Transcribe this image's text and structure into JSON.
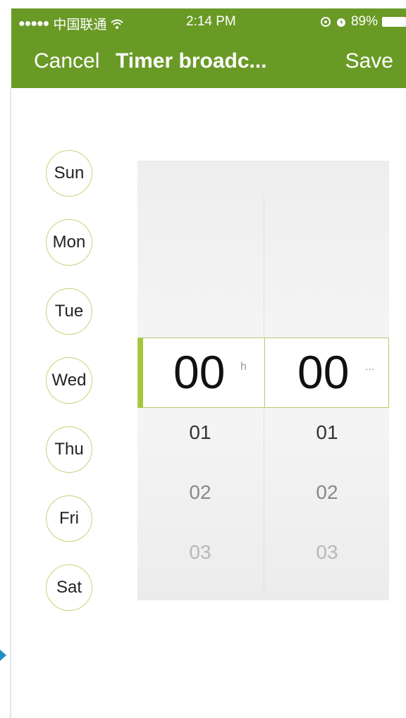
{
  "status_bar": {
    "signal": "●●●●●",
    "carrier": "中国联通",
    "time": "2:14 PM",
    "battery": "89%",
    "icons": [
      "wifi-icon",
      "location-icon",
      "alarm-icon",
      "battery-icon"
    ]
  },
  "nav": {
    "cancel_label": "Cancel",
    "title": "Timer broadc...",
    "save_label": "Save"
  },
  "days": [
    "Sun",
    "Mon",
    "Tue",
    "Wed",
    "Thu",
    "Fri",
    "Sat"
  ],
  "picker": {
    "hour": {
      "selected": "00",
      "unit": "h",
      "below": [
        "01",
        "02",
        "03"
      ]
    },
    "minute": {
      "selected": "00",
      "unit": "...",
      "below": [
        "01",
        "02",
        "03"
      ]
    }
  },
  "colors": {
    "header_bg": "#6a9a26",
    "accent": "#a6c63a",
    "circle_border": "#c8d27a"
  }
}
